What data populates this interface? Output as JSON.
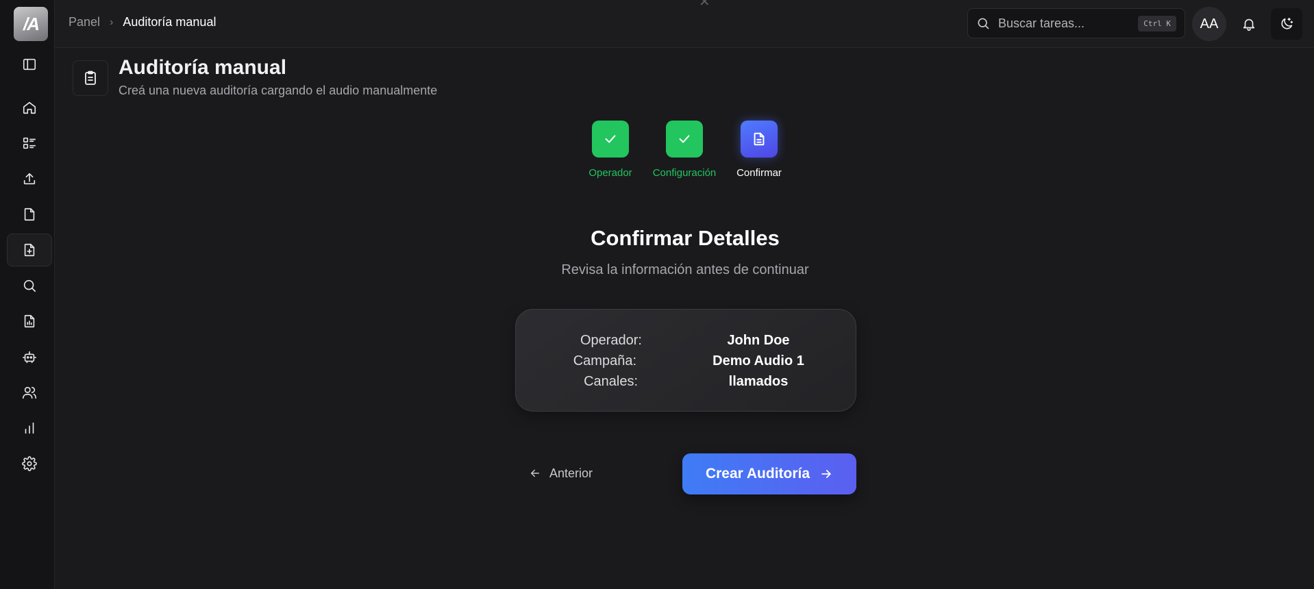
{
  "app": {
    "logo_text": "/A"
  },
  "sidebar": {
    "items": [
      {
        "name": "toggle-sidebar",
        "icon": "sidebar-toggle-icon"
      },
      {
        "name": "home",
        "icon": "home-icon"
      },
      {
        "name": "tasks",
        "icon": "list-icon"
      },
      {
        "name": "upload",
        "icon": "upload-icon"
      },
      {
        "name": "document",
        "icon": "file-icon"
      },
      {
        "name": "new-audit",
        "icon": "file-plus-icon",
        "active": true
      },
      {
        "name": "search",
        "icon": "search-icon"
      },
      {
        "name": "reports",
        "icon": "file-chart-icon"
      },
      {
        "name": "robot",
        "icon": "bot-icon"
      },
      {
        "name": "users",
        "icon": "users-icon"
      },
      {
        "name": "analytics",
        "icon": "bar-chart-icon"
      },
      {
        "name": "settings",
        "icon": "gear-icon"
      }
    ]
  },
  "header": {
    "breadcrumb": {
      "root": "Panel",
      "separator": "›",
      "current": "Auditoría manual"
    },
    "search": {
      "placeholder": "Buscar tareas...",
      "shortcut": "Ctrl K"
    },
    "avatar_initials": "AA"
  },
  "page": {
    "title": "Auditoría manual",
    "subtitle": "Creá una nueva auditoría cargando el audio manualmente"
  },
  "steps": [
    {
      "label": "Operador",
      "status": "done"
    },
    {
      "label": "Configuración",
      "status": "done"
    },
    {
      "label": "Confirmar",
      "status": "current"
    }
  ],
  "confirm": {
    "title": "Confirmar Detalles",
    "subtitle": "Revisa la información antes de continuar",
    "rows": [
      {
        "label": "Operador:",
        "value": "John Doe"
      },
      {
        "label": "Campaña:",
        "value": "Demo Audio 1"
      },
      {
        "label": "Canales:",
        "value": "llamados"
      }
    ]
  },
  "actions": {
    "previous_label": "Anterior",
    "create_label": "Crear Auditoría"
  },
  "colors": {
    "background": "#1a1a1d",
    "success": "#22c55e",
    "accent_start": "#3f7cf5",
    "accent_end": "#5b5ff0"
  }
}
